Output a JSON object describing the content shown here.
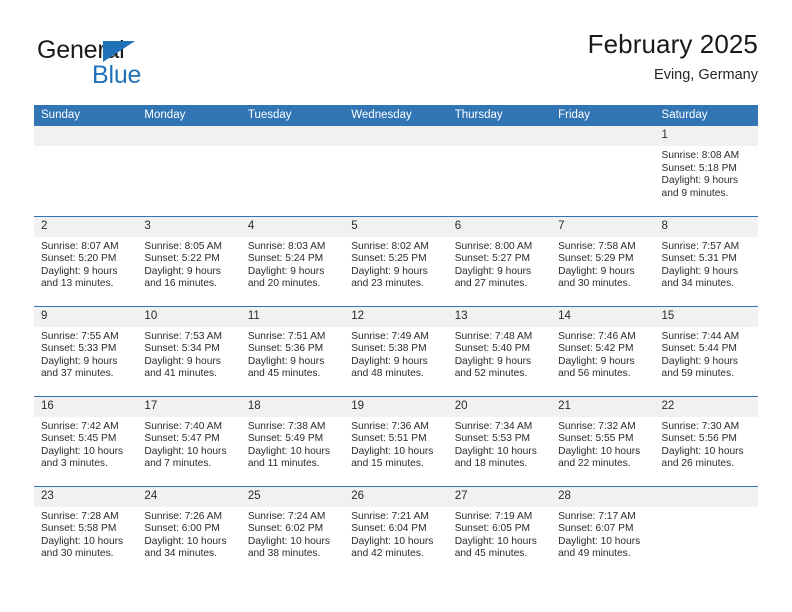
{
  "brand": {
    "name_part1": "General",
    "name_part2": "Blue",
    "accent_color": "#1f71b8"
  },
  "header": {
    "title": "February 2025",
    "subtitle": "Eving, Germany"
  },
  "theme": {
    "header_row_color": "#3175b5",
    "daynum_band_color": "#f1f1f1",
    "text_color": "#2b2b2b"
  },
  "weekdays": [
    "Sunday",
    "Monday",
    "Tuesday",
    "Wednesday",
    "Thursday",
    "Friday",
    "Saturday"
  ],
  "labels": {
    "sunrise_prefix": "Sunrise:",
    "sunset_prefix": "Sunset:",
    "daylight_prefix": "Daylight:"
  },
  "weeks": [
    [
      {
        "day": "",
        "empty": true
      },
      {
        "day": "",
        "empty": true
      },
      {
        "day": "",
        "empty": true
      },
      {
        "day": "",
        "empty": true
      },
      {
        "day": "",
        "empty": true
      },
      {
        "day": "",
        "empty": true
      },
      {
        "day": "1",
        "sunrise": "Sunrise: 8:08 AM",
        "sunset": "Sunset: 5:18 PM",
        "daylight_line1": "Daylight: 9 hours",
        "daylight_line2": "and 9 minutes."
      }
    ],
    [
      {
        "day": "2",
        "sunrise": "Sunrise: 8:07 AM",
        "sunset": "Sunset: 5:20 PM",
        "daylight_line1": "Daylight: 9 hours",
        "daylight_line2": "and 13 minutes."
      },
      {
        "day": "3",
        "sunrise": "Sunrise: 8:05 AM",
        "sunset": "Sunset: 5:22 PM",
        "daylight_line1": "Daylight: 9 hours",
        "daylight_line2": "and 16 minutes."
      },
      {
        "day": "4",
        "sunrise": "Sunrise: 8:03 AM",
        "sunset": "Sunset: 5:24 PM",
        "daylight_line1": "Daylight: 9 hours",
        "daylight_line2": "and 20 minutes."
      },
      {
        "day": "5",
        "sunrise": "Sunrise: 8:02 AM",
        "sunset": "Sunset: 5:25 PM",
        "daylight_line1": "Daylight: 9 hours",
        "daylight_line2": "and 23 minutes."
      },
      {
        "day": "6",
        "sunrise": "Sunrise: 8:00 AM",
        "sunset": "Sunset: 5:27 PM",
        "daylight_line1": "Daylight: 9 hours",
        "daylight_line2": "and 27 minutes."
      },
      {
        "day": "7",
        "sunrise": "Sunrise: 7:58 AM",
        "sunset": "Sunset: 5:29 PM",
        "daylight_line1": "Daylight: 9 hours",
        "daylight_line2": "and 30 minutes."
      },
      {
        "day": "8",
        "sunrise": "Sunrise: 7:57 AM",
        "sunset": "Sunset: 5:31 PM",
        "daylight_line1": "Daylight: 9 hours",
        "daylight_line2": "and 34 minutes."
      }
    ],
    [
      {
        "day": "9",
        "sunrise": "Sunrise: 7:55 AM",
        "sunset": "Sunset: 5:33 PM",
        "daylight_line1": "Daylight: 9 hours",
        "daylight_line2": "and 37 minutes."
      },
      {
        "day": "10",
        "sunrise": "Sunrise: 7:53 AM",
        "sunset": "Sunset: 5:34 PM",
        "daylight_line1": "Daylight: 9 hours",
        "daylight_line2": "and 41 minutes."
      },
      {
        "day": "11",
        "sunrise": "Sunrise: 7:51 AM",
        "sunset": "Sunset: 5:36 PM",
        "daylight_line1": "Daylight: 9 hours",
        "daylight_line2": "and 45 minutes."
      },
      {
        "day": "12",
        "sunrise": "Sunrise: 7:49 AM",
        "sunset": "Sunset: 5:38 PM",
        "daylight_line1": "Daylight: 9 hours",
        "daylight_line2": "and 48 minutes."
      },
      {
        "day": "13",
        "sunrise": "Sunrise: 7:48 AM",
        "sunset": "Sunset: 5:40 PM",
        "daylight_line1": "Daylight: 9 hours",
        "daylight_line2": "and 52 minutes."
      },
      {
        "day": "14",
        "sunrise": "Sunrise: 7:46 AM",
        "sunset": "Sunset: 5:42 PM",
        "daylight_line1": "Daylight: 9 hours",
        "daylight_line2": "and 56 minutes."
      },
      {
        "day": "15",
        "sunrise": "Sunrise: 7:44 AM",
        "sunset": "Sunset: 5:44 PM",
        "daylight_line1": "Daylight: 9 hours",
        "daylight_line2": "and 59 minutes."
      }
    ],
    [
      {
        "day": "16",
        "sunrise": "Sunrise: 7:42 AM",
        "sunset": "Sunset: 5:45 PM",
        "daylight_line1": "Daylight: 10 hours",
        "daylight_line2": "and 3 minutes."
      },
      {
        "day": "17",
        "sunrise": "Sunrise: 7:40 AM",
        "sunset": "Sunset: 5:47 PM",
        "daylight_line1": "Daylight: 10 hours",
        "daylight_line2": "and 7 minutes."
      },
      {
        "day": "18",
        "sunrise": "Sunrise: 7:38 AM",
        "sunset": "Sunset: 5:49 PM",
        "daylight_line1": "Daylight: 10 hours",
        "daylight_line2": "and 11 minutes."
      },
      {
        "day": "19",
        "sunrise": "Sunrise: 7:36 AM",
        "sunset": "Sunset: 5:51 PM",
        "daylight_line1": "Daylight: 10 hours",
        "daylight_line2": "and 15 minutes."
      },
      {
        "day": "20",
        "sunrise": "Sunrise: 7:34 AM",
        "sunset": "Sunset: 5:53 PM",
        "daylight_line1": "Daylight: 10 hours",
        "daylight_line2": "and 18 minutes."
      },
      {
        "day": "21",
        "sunrise": "Sunrise: 7:32 AM",
        "sunset": "Sunset: 5:55 PM",
        "daylight_line1": "Daylight: 10 hours",
        "daylight_line2": "and 22 minutes."
      },
      {
        "day": "22",
        "sunrise": "Sunrise: 7:30 AM",
        "sunset": "Sunset: 5:56 PM",
        "daylight_line1": "Daylight: 10 hours",
        "daylight_line2": "and 26 minutes."
      }
    ],
    [
      {
        "day": "23",
        "sunrise": "Sunrise: 7:28 AM",
        "sunset": "Sunset: 5:58 PM",
        "daylight_line1": "Daylight: 10 hours",
        "daylight_line2": "and 30 minutes."
      },
      {
        "day": "24",
        "sunrise": "Sunrise: 7:26 AM",
        "sunset": "Sunset: 6:00 PM",
        "daylight_line1": "Daylight: 10 hours",
        "daylight_line2": "and 34 minutes."
      },
      {
        "day": "25",
        "sunrise": "Sunrise: 7:24 AM",
        "sunset": "Sunset: 6:02 PM",
        "daylight_line1": "Daylight: 10 hours",
        "daylight_line2": "and 38 minutes."
      },
      {
        "day": "26",
        "sunrise": "Sunrise: 7:21 AM",
        "sunset": "Sunset: 6:04 PM",
        "daylight_line1": "Daylight: 10 hours",
        "daylight_line2": "and 42 minutes."
      },
      {
        "day": "27",
        "sunrise": "Sunrise: 7:19 AM",
        "sunset": "Sunset: 6:05 PM",
        "daylight_line1": "Daylight: 10 hours",
        "daylight_line2": "and 45 minutes."
      },
      {
        "day": "28",
        "sunrise": "Sunrise: 7:17 AM",
        "sunset": "Sunset: 6:07 PM",
        "daylight_line1": "Daylight: 10 hours",
        "daylight_line2": "and 49 minutes."
      },
      {
        "day": "",
        "empty": true
      }
    ]
  ]
}
